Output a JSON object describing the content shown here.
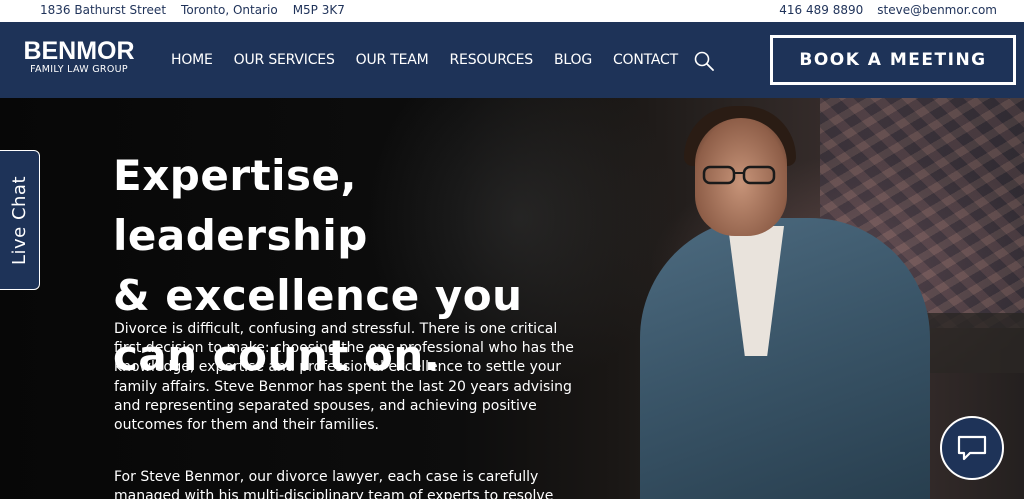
{
  "topbar": {
    "street": "1836 Bathurst Street",
    "city": "Toronto, Ontario",
    "postal": "M5P 3K7",
    "phone": "416 489 8890",
    "email": "steve@benmor.com"
  },
  "logo": {
    "name": "BENMOR",
    "tagline": "FAMILY LAW GROUP"
  },
  "nav": {
    "items": [
      "HOME",
      "OUR SERVICES",
      "OUR TEAM",
      "RESOURCES",
      "BLOG",
      "CONTACT"
    ],
    "search_icon": "search-icon",
    "book_label": "BOOK A MEETING"
  },
  "hero": {
    "headline_1": "Expertise, leadership",
    "headline_2": "& excellence you",
    "headline_3": "can count on.",
    "paragraph": "Divorce is difficult, confusing and stressful. There is one critical first decision to make: choosing the one professional who has the knowledge, expertise and professional excellence to settle your family affairs. Steve Benmor has spent the last 20 years advising and representing separated spouses, and achieving positive outcomes for them and their families.",
    "paragraph_2": "For Steve Benmor, our divorce lawyer, each case is carefully managed with his multi-disciplinary team of experts to resolve"
  },
  "widgets": {
    "live_chat": "Live Chat",
    "chat_icon": "chat-bubble-icon"
  },
  "colors": {
    "navy": "#1e3358",
    "white": "#ffffff"
  }
}
